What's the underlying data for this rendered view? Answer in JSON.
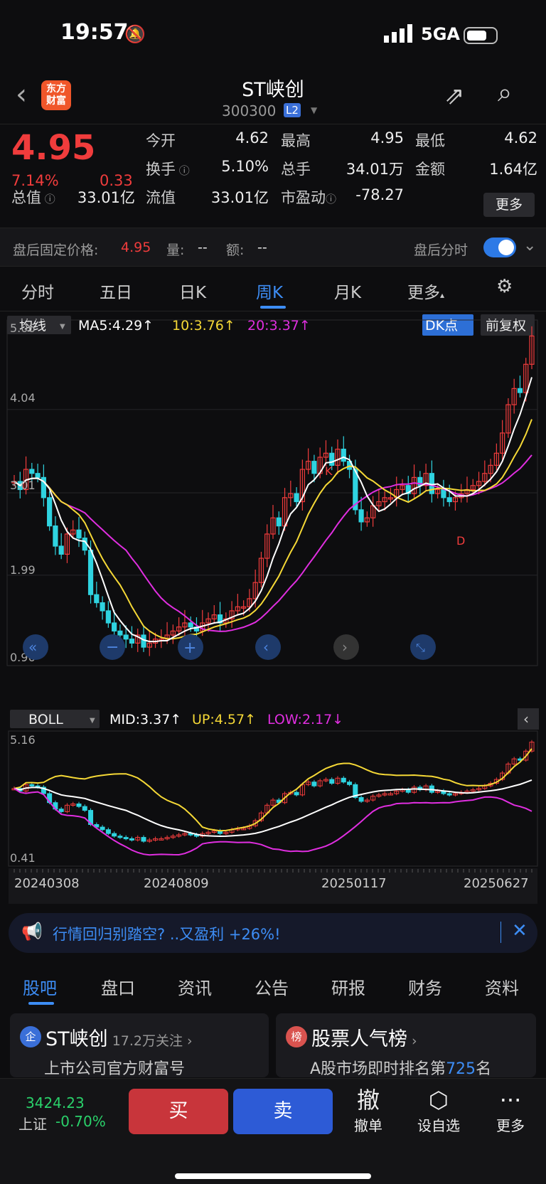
{
  "status": {
    "time": "19:57",
    "network": "5GA"
  },
  "header": {
    "logo": "东方\n财富",
    "name": "ST峡创",
    "code": "300300",
    "level": "L2"
  },
  "quote": {
    "price": "4.95",
    "pct": "7.14%",
    "change": "0.33",
    "fields": [
      {
        "label": "今开",
        "value": "4.62"
      },
      {
        "label": "最高",
        "value": "4.95",
        "red": true
      },
      {
        "label": "最低",
        "value": "4.62"
      },
      {
        "label": "换手",
        "value": "5.10%"
      },
      {
        "label": "总手",
        "value": "34.01万"
      },
      {
        "label": "金额",
        "value": "1.64亿"
      },
      {
        "label": "总值",
        "value": "33.01亿"
      },
      {
        "label": "流值",
        "value": "33.01亿"
      },
      {
        "label": "市盈动",
        "value": "-78.27"
      }
    ],
    "more": "更多"
  },
  "after_hours": {
    "label": "盘后固定价格:",
    "price": "4.95",
    "vol_label": "量:",
    "vol": "--",
    "amt_label": "额:",
    "amt": "--",
    "fenshi": "盘后分时"
  },
  "period_tabs": [
    "分时",
    "五日",
    "日K",
    "周K",
    "月K",
    "更多"
  ],
  "active_period": "周K",
  "ma_bar": {
    "selector": "均线",
    "ma5": "MA5:4.29↑",
    "ma10": "10:3.76↑",
    "ma20": "20:3.37↑",
    "dk": "DK点",
    "fq": "前复权"
  },
  "boll_bar": {
    "selector": "BOLL",
    "mid": "MID:3.37↑",
    "up": "UP:4.57↑",
    "low": "LOW:2.17↓"
  },
  "colors": {
    "up": "#f03c3c",
    "down": "#2fd3e0",
    "ma5": "#ffffff",
    "ma10": "#f5d836",
    "ma20": "#e02ee0",
    "accent": "#3d8df5"
  },
  "chart_data": {
    "type": "candlestick",
    "period": "weekly",
    "price_axis": [
      "5.06",
      "4.04",
      "3.01",
      "1.99",
      "0.96"
    ],
    "boll_axis": [
      "5.16",
      "0.41"
    ],
    "dates": [
      "20240308",
      "20240809",
      "20250117",
      "20250627"
    ],
    "markers": [
      "K",
      "D"
    ],
    "ma5": 4.29,
    "ma10": 3.76,
    "ma20": 3.37,
    "boll_mid": 3.37,
    "boll_up": 4.57,
    "boll_low": 2.17,
    "closes": [
      3.15,
      3.05,
      3.3,
      3.25,
      3.2,
      2.95,
      2.6,
      2.35,
      2.25,
      2.5,
      2.55,
      2.45,
      2.3,
      1.75,
      1.65,
      1.55,
      1.4,
      1.3,
      1.25,
      1.2,
      1.15,
      1.25,
      1.1,
      1.15,
      1.2,
      1.2,
      1.25,
      1.3,
      1.35,
      1.4,
      1.35,
      1.3,
      1.4,
      1.45,
      1.5,
      1.4,
      1.45,
      1.55,
      1.6,
      1.6,
      1.7,
      1.9,
      2.2,
      2.5,
      2.7,
      2.6,
      2.95,
      3.0,
      2.9,
      3.3,
      3.4,
      3.25,
      3.45,
      3.5,
      3.35,
      3.55,
      3.4,
      3.3,
      2.8,
      2.65,
      2.7,
      2.85,
      2.9,
      2.95,
      2.95,
      3.05,
      3.1,
      3.0,
      3.2,
      3.1,
      3.25,
      3.0,
      3.05,
      2.95,
      2.9,
      2.95,
      3.0,
      3.05,
      3.1,
      3.15,
      3.25,
      3.35,
      3.5,
      3.75,
      4.1,
      4.3,
      4.25,
      4.6,
      4.95
    ]
  },
  "banner": {
    "text": "行情回归别踏空? ..又盈利 +26%!"
  },
  "bottom_tabs": [
    "股吧",
    "盘口",
    "资讯",
    "公告",
    "研报",
    "财务",
    "资料"
  ],
  "cards": [
    {
      "icon": "企",
      "title": "ST峡创",
      "follow": "17.2万关注",
      "sub": "上市公司官方财富号"
    },
    {
      "icon": "榜",
      "title": "股票人气榜",
      "sub_pre": "A股市场即时排名第",
      "rank": "725",
      "sub_post": "名"
    }
  ],
  "footer": {
    "index_value": "3424.23",
    "index_label": "上证",
    "index_change": "-0.70%",
    "buy": "买",
    "sell": "卖",
    "actions": [
      {
        "icon": "撤",
        "label": "撤单"
      },
      {
        "icon": "⬡",
        "label": "设自选"
      },
      {
        "icon": "···",
        "label": "更多"
      }
    ]
  }
}
